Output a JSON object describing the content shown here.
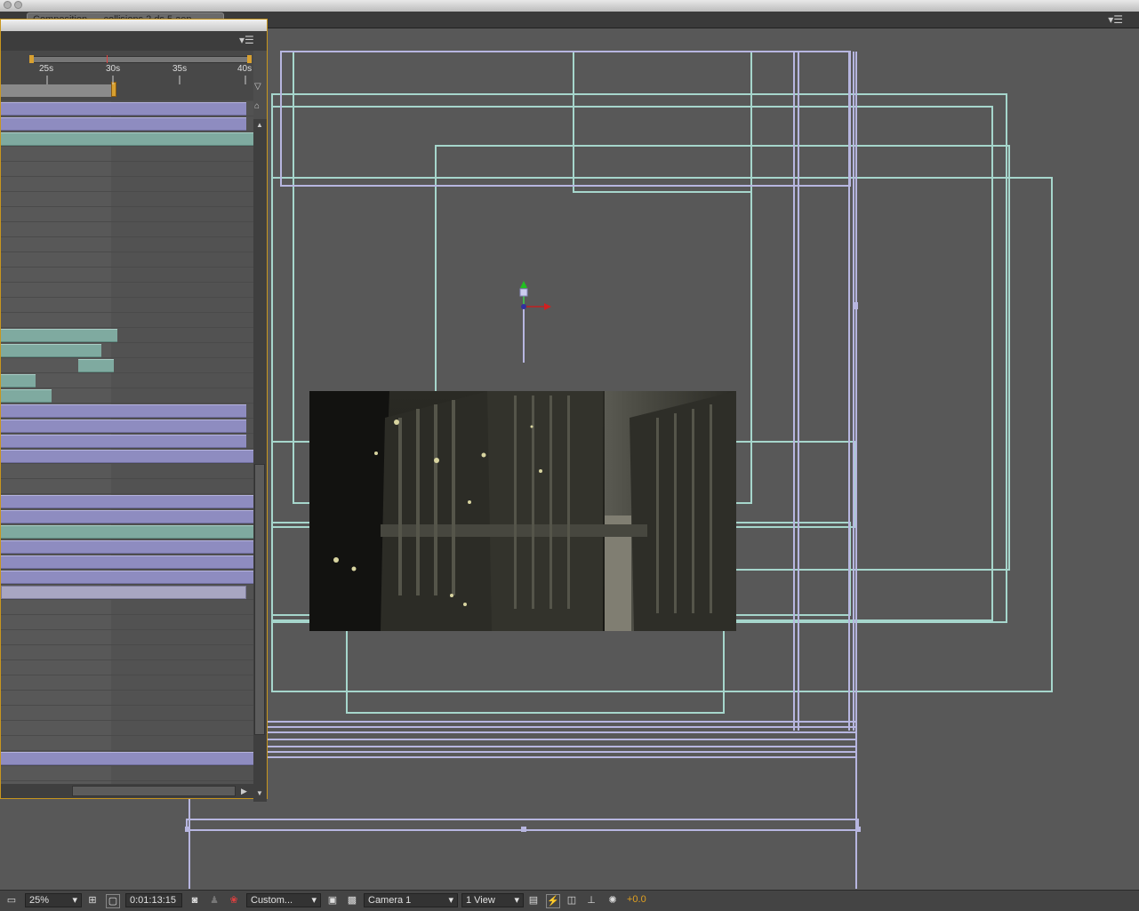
{
  "app": {
    "tab_title": "Composition ..._collisions 2 ds 5.aep"
  },
  "timeline": {
    "ruler_ticks": [
      "25s",
      "30s",
      "35s",
      "40s"
    ]
  },
  "statusbar": {
    "zoom": "25%",
    "timecode": "0:01:13:15",
    "resolution": "Custom...",
    "camera": "Camera 1",
    "view_layout": "1 View",
    "exposure": "+0.0"
  },
  "colors": {
    "layer_purple": "#8e8cc0",
    "layer_teal": "#7faaa0",
    "wire_teal": "#a6d6cc",
    "wire_lavender": "#b7b6e0",
    "exposure_orange": "#e0a020",
    "panel_border": "#c8961e"
  },
  "icons": [
    "panel-menu-icon",
    "region-of-interest-icon",
    "transparency-grid-icon",
    "snapshot-icon",
    "color-channel-icon",
    "fast-preview-icon",
    "3d-view-icon",
    "reset-exposure-icon"
  ]
}
